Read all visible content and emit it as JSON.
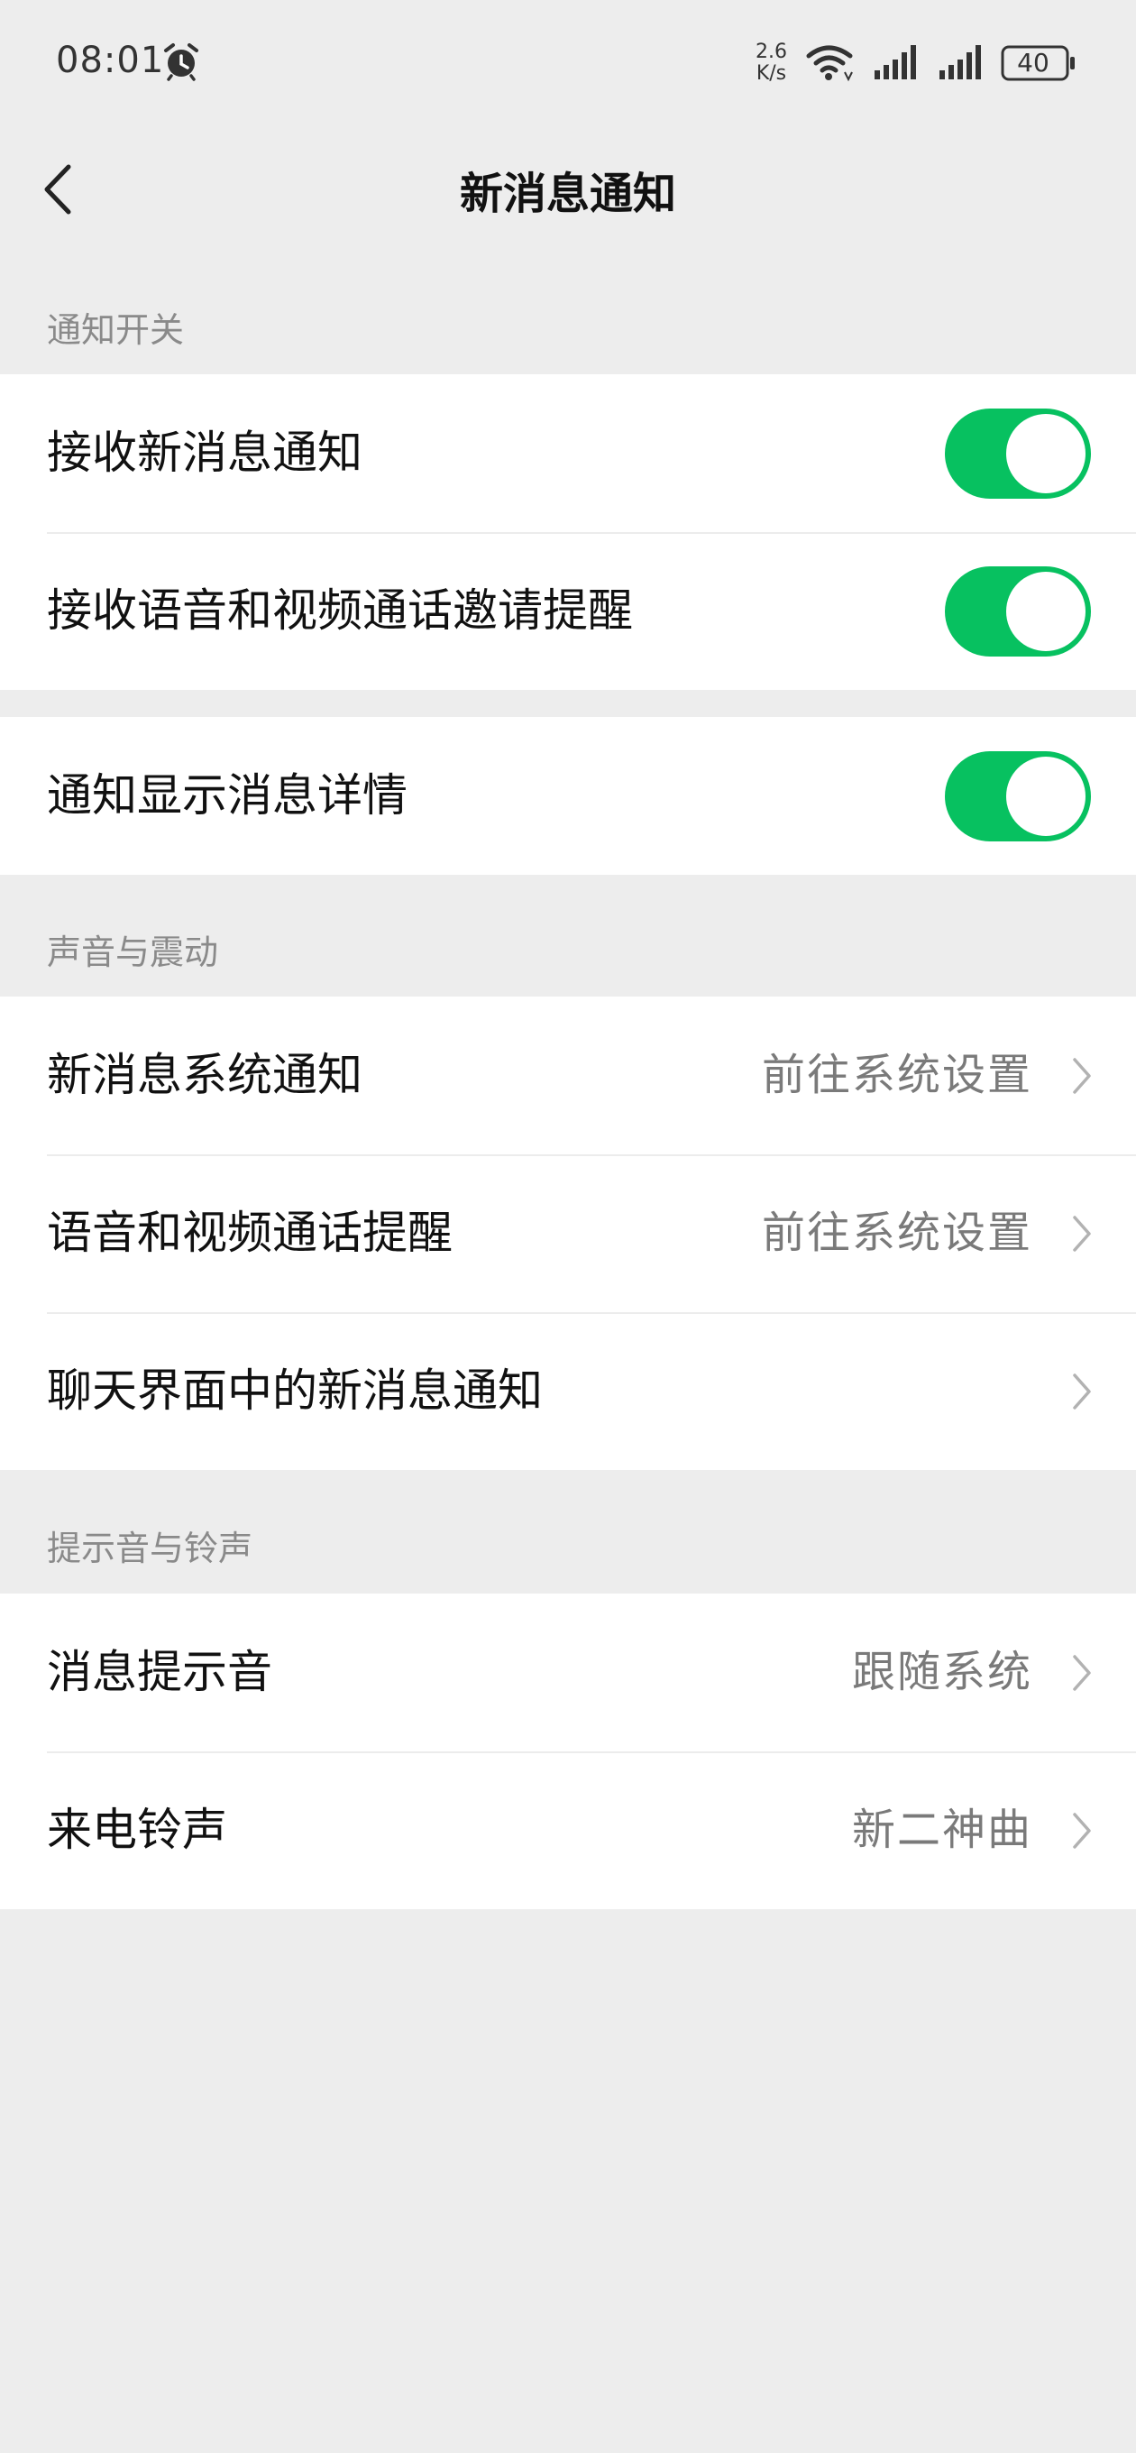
{
  "status_bar": {
    "time": "08:01",
    "net_speed_value": "2.6",
    "net_speed_unit": "K/s",
    "battery": "40",
    "icons": [
      "alarm-icon",
      "wifi-icon",
      "signal-icon",
      "signal-icon",
      "battery-icon"
    ]
  },
  "header": {
    "title": "新消息通知",
    "back_icon": "back-arrow-icon"
  },
  "accent_color": "#07c160",
  "sections": {
    "notify_switch": {
      "label": "通知开关",
      "items": [
        {
          "label": "接收新消息通知",
          "toggle": true
        },
        {
          "label": "接收语音和视频通话邀请提醒",
          "toggle": true
        }
      ]
    },
    "details": {
      "items": [
        {
          "label": "通知显示消息详情",
          "toggle": true
        }
      ]
    },
    "sound_vibration": {
      "label": "声音与震动",
      "items": [
        {
          "label": "新消息系统通知",
          "value": "前往系统设置"
        },
        {
          "label": "语音和视频通话提醒",
          "value": "前往系统设置"
        },
        {
          "label": "聊天界面中的新消息通知",
          "value": ""
        }
      ]
    },
    "tones": {
      "label": "提示音与铃声",
      "items": [
        {
          "label": "消息提示音",
          "value": "跟随系统"
        },
        {
          "label": "来电铃声",
          "value": "新二神曲"
        }
      ]
    }
  }
}
